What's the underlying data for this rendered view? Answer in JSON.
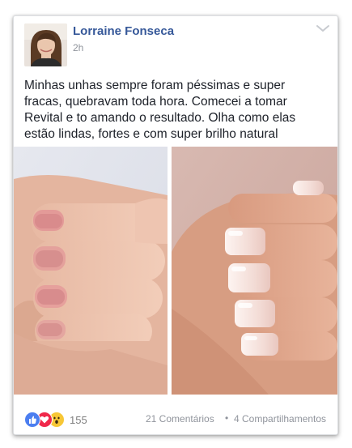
{
  "post": {
    "author": "Lorraine Fonseca",
    "time": "2h",
    "text": "Minhas unhas sempre foram péssimas e super fracas, quebravam toda hora. Comecei a tomar Revital e to amando o resultado. Olha como elas estão lindas, fortes e com super brilho natural"
  },
  "icons": {
    "menu": "chevron-down-icon",
    "like": "thumbs-up-icon",
    "love": "heart-icon",
    "wow": "wow-face-icon"
  },
  "footer": {
    "reaction_count": "155",
    "comments_label": "21 Comentários",
    "separator": "•",
    "shares_label": "4 Compartilhamentos"
  },
  "colors": {
    "author_link": "#365899",
    "meta_text": "#90949c",
    "like_blue": "#4b7ef0",
    "love_red": "#f0284a",
    "wow_yellow": "#f7c736"
  }
}
